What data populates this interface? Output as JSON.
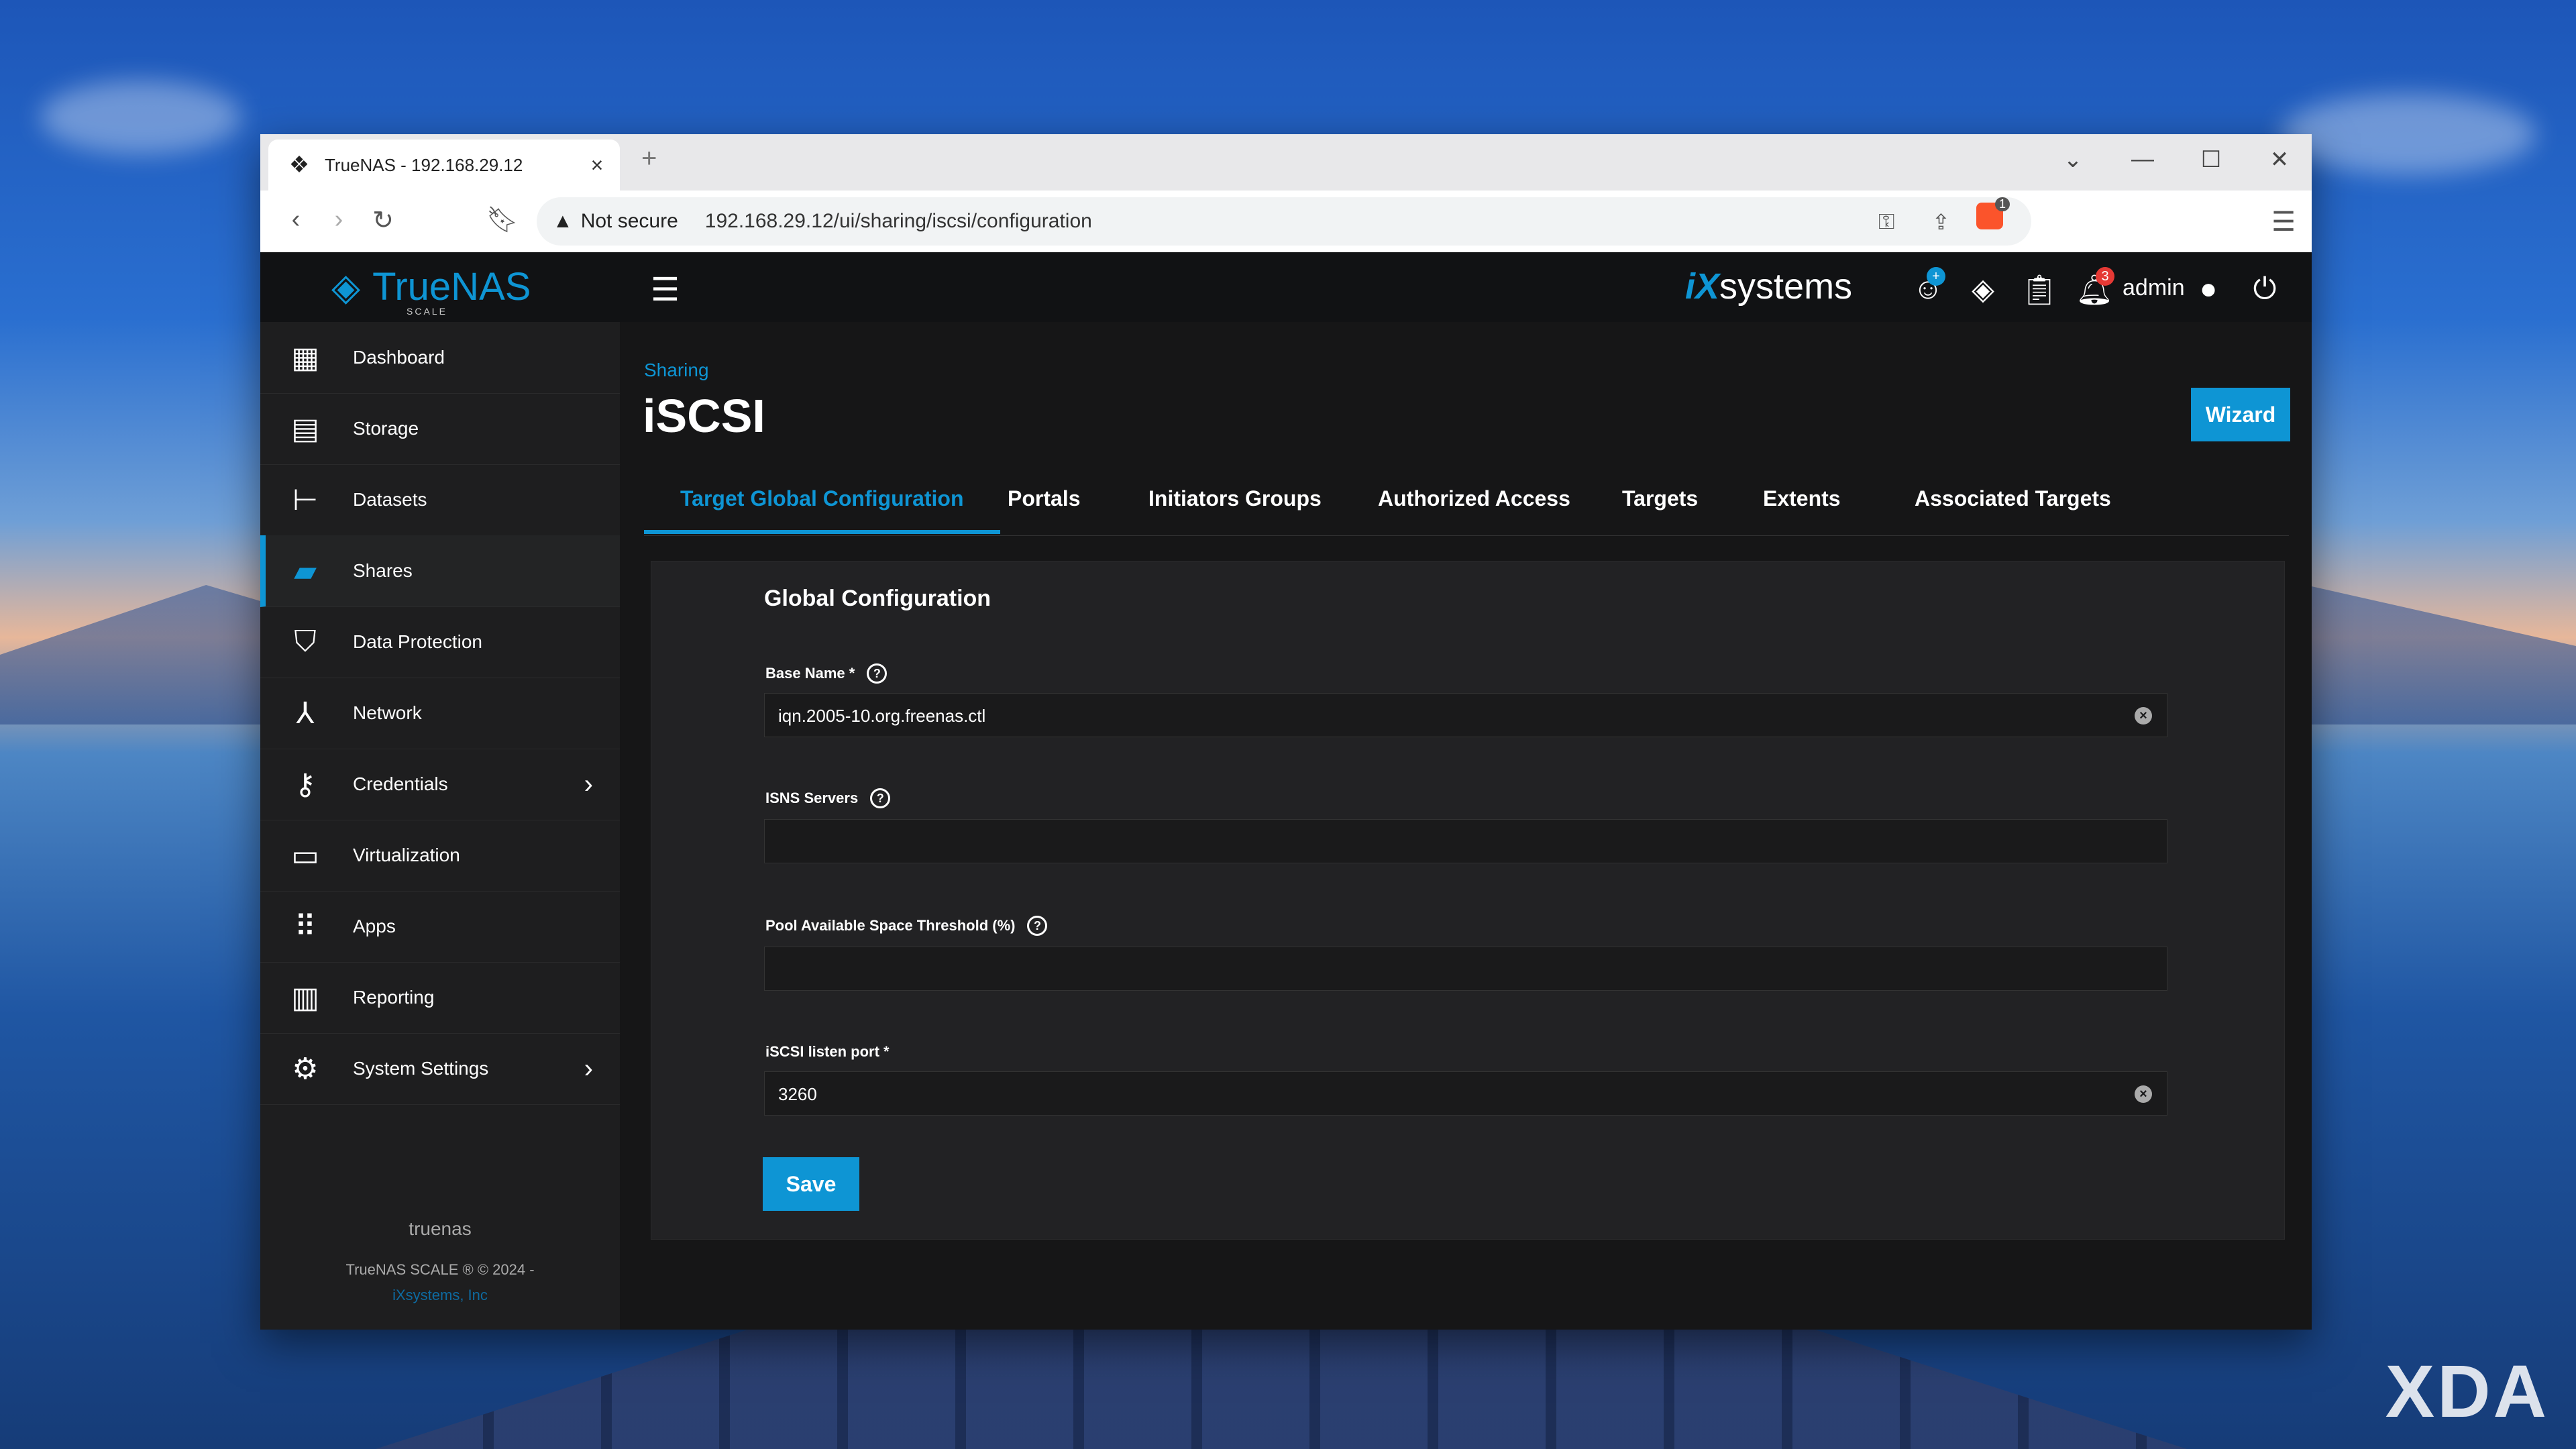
{
  "browser": {
    "tab_title": "TrueNAS - 192.168.29.12",
    "security_label": "Not secure",
    "url": "192.168.29.12/ui/sharing/iscsi/configuration",
    "extension_badge": "1"
  },
  "header": {
    "brand": "TrueNAS",
    "brand_sub": "SCALE",
    "vendor_prefix": "iX",
    "vendor_suffix": "systems",
    "notification_count": "3",
    "user": "admin"
  },
  "sidebar": {
    "items": [
      {
        "label": "Dashboard",
        "icon": "dashboard-icon"
      },
      {
        "label": "Storage",
        "icon": "storage-icon"
      },
      {
        "label": "Datasets",
        "icon": "datasets-icon"
      },
      {
        "label": "Shares",
        "icon": "shares-icon"
      },
      {
        "label": "Data Protection",
        "icon": "shield-icon"
      },
      {
        "label": "Network",
        "icon": "network-icon"
      },
      {
        "label": "Credentials",
        "icon": "key-icon"
      },
      {
        "label": "Virtualization",
        "icon": "laptop-icon"
      },
      {
        "label": "Apps",
        "icon": "apps-grid-icon"
      },
      {
        "label": "Reporting",
        "icon": "chart-icon"
      },
      {
        "label": "System Settings",
        "icon": "gear-icon"
      }
    ],
    "hostname": "truenas",
    "copyright": "TrueNAS SCALE ® © 2024 -",
    "company": "iXsystems, Inc"
  },
  "page": {
    "breadcrumb": "Sharing",
    "title": "iSCSI",
    "wizard_label": "Wizard",
    "tabs": [
      "Target Global Configuration",
      "Portals",
      "Initiators Groups",
      "Authorized Access",
      "Targets",
      "Extents",
      "Associated Targets"
    ],
    "active_tab": "Target Global Configuration"
  },
  "form": {
    "title": "Global Configuration",
    "base_name_label": "Base Name *",
    "base_name_value": "iqn.2005-10.org.freenas.ctl",
    "isns_label": "ISNS Servers",
    "isns_value": "",
    "pool_label": "Pool Available Space Threshold (%)",
    "pool_value": "",
    "port_label": "iSCSI listen port *",
    "port_value": "3260",
    "save_label": "Save"
  },
  "colors": {
    "accent": "#0e95d4",
    "notification": "#e53935"
  },
  "watermark": "XDA"
}
